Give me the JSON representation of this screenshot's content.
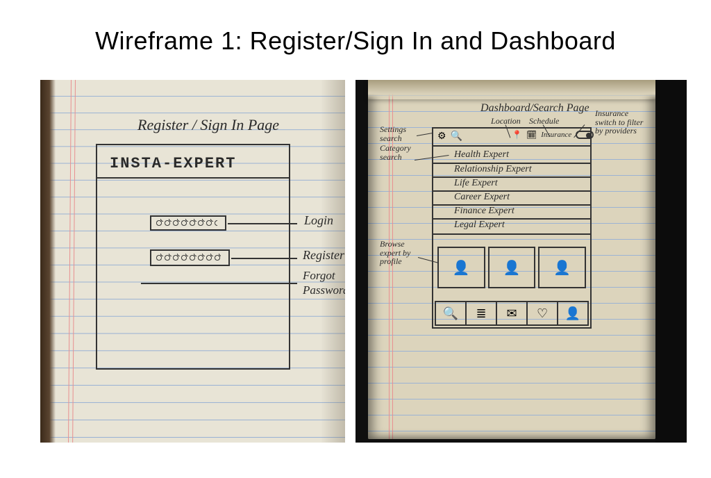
{
  "title": "Wireframe 1: Register/Sign In and Dashboard",
  "left": {
    "page_label": "Register / Sign In Page",
    "brand": "INSTA-EXPERT",
    "annotations": {
      "login": "Login",
      "register": "Register",
      "forgot_l1": "Forgot",
      "forgot_l2": "Password"
    }
  },
  "right": {
    "page_label": "Dashboard/Search Page",
    "sub_labels": {
      "location": "Location",
      "schedule": "Schedule"
    },
    "insurance_note": "Insurance switch to filter by providers",
    "left_notes": {
      "settings_search": "Settings search",
      "category_search": "Category search",
      "browse": "Browse expert by profile"
    },
    "top_icons": {
      "gear": "gear-icon",
      "search": "search-icon",
      "pin": "pin-icon",
      "calendar": "calendar-icon",
      "insurance_label": "Insurance"
    },
    "categories": [
      "Health Expert",
      "Relationship Expert",
      "Life Expert",
      "Career Expert",
      "Finance Expert",
      "Legal Expert"
    ],
    "nav_icons": [
      "search-icon",
      "list-icon",
      "mail-icon",
      "heart-icon",
      "profile-icon"
    ]
  }
}
